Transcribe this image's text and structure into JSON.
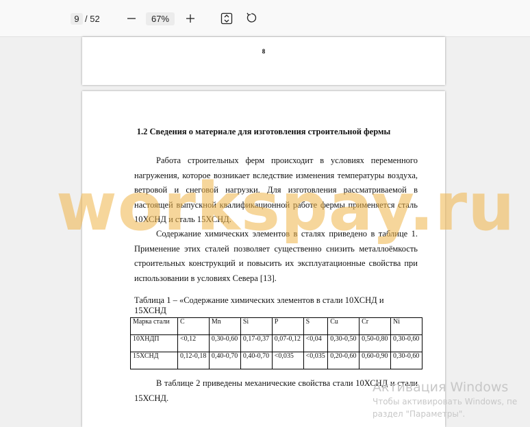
{
  "toolbar": {
    "page_current": "9",
    "page_total": "/ 52",
    "zoom_out_icon": "minus-icon",
    "zoom_level": "67%",
    "zoom_in_icon": "plus-icon",
    "fit_icon": "fit-page-icon",
    "rotate_icon": "rotate-icon"
  },
  "prev_page": {
    "number": "8"
  },
  "current_page": {
    "heading": "1.2 Сведения о материале для изготовления строительной фермы",
    "paragraph1": "Работа строительных ферм происходит в условиях переменного нагружения, которое возникает вследствие изменения температуры воздуха, ветровой и снеговой нагрузки. Для изготовления рассматриваемой в настоящей выпускной квалификационной работе фермы применяется сталь 10ХСНД и сталь 15ХСНД.",
    "paragraph2": "Содержание химических элементов в сталях приведено в таблице 1. Применение этих сталей позволяет существенно снизить металлоёмкость строительных конструкций и повысить их эксплуатационные свойства при использовании в условиях Севера [13].",
    "table_caption": "Таблица 1 – «Содержание химических элементов в стали 10ХСНД и 15ХСНД",
    "table": {
      "headers": [
        "Марка стали",
        "C",
        "Mn",
        "Si",
        "P",
        "S",
        "Cu",
        "Cr",
        "Ni"
      ],
      "rows": [
        [
          "10ХНДП",
          "<0,12",
          "0,30-0,60",
          "0,17-0,37",
          "0,07-0,12",
          "<0,04",
          "0,30-0,50",
          "0,50-0,80",
          "0,30-0,60"
        ],
        [
          "15ХСНД",
          "0,12-0,18",
          "0,40-0,70",
          "0,40-0,70",
          "<0,035",
          "<0,035",
          "0,20-0,60",
          "0,60-0,90",
          "0,30-0,60"
        ]
      ]
    },
    "paragraph3": "В таблице 2 приведены механические свойства стали 10ХСНД и стали 15ХСНД."
  },
  "watermark": "workspay.ru",
  "activation": {
    "title": "Активация Windows",
    "line1": "Чтобы активировать Windows, пе",
    "line2": "раздел \"Параметры\"."
  }
}
